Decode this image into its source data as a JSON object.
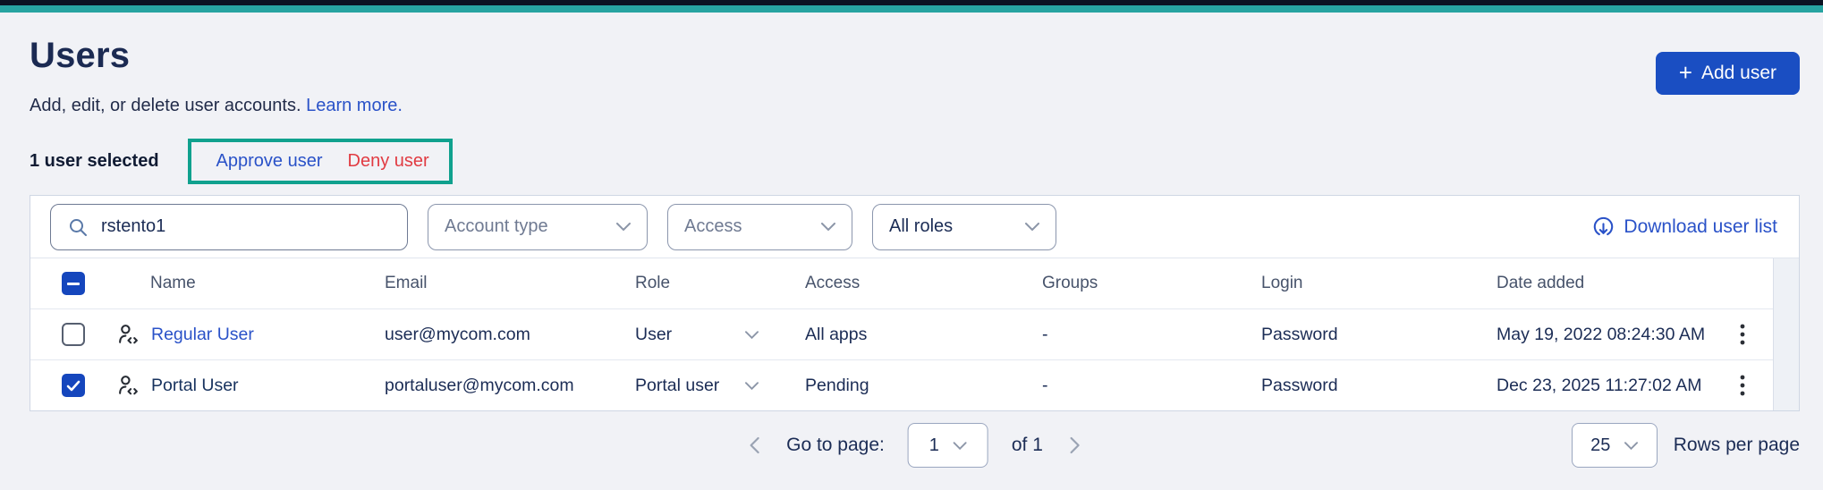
{
  "page": {
    "title": "Users",
    "subtitle": "Add, edit, or delete user accounts.",
    "learn_more_label": "Learn more.",
    "add_user_button": "Add user"
  },
  "selection": {
    "count_label": "1 user selected",
    "approve_label": "Approve user",
    "deny_label": "Deny user"
  },
  "filters": {
    "search_value": "rstento1",
    "account_type_label": "Account type",
    "access_label": "Access",
    "roles_label": "All roles",
    "download_label": "Download user list"
  },
  "table": {
    "columns": {
      "name": "Name",
      "email": "Email",
      "role": "Role",
      "access": "Access",
      "groups": "Groups",
      "login": "Login",
      "date_added": "Date added"
    },
    "rows": [
      {
        "selected": false,
        "name": "Regular User",
        "email": "user@mycom.com",
        "role": "User",
        "access": "All apps",
        "groups": "-",
        "login": "Password",
        "date_added": "May 19, 2022 08:24:30 AM"
      },
      {
        "selected": true,
        "name": "Portal User",
        "email": "portaluser@mycom.com",
        "role": "Portal user",
        "access": "Pending",
        "groups": "-",
        "login": "Password",
        "date_added": "Dec 23, 2025 11:27:02 AM"
      }
    ]
  },
  "pagination": {
    "go_to_page_label": "Go to page:",
    "page_value": "1",
    "of_label": "of 1",
    "rows_per_page_value": "25",
    "rows_per_page_label": "Rows per page"
  },
  "colors": {
    "top_accent_bar": "#27a4a1",
    "primary_button_blue": "#1a4ec2",
    "link_blue": "#2a52c8",
    "danger_red": "#e13b42",
    "annotation_highlight_teal": "#10a18e",
    "navy_text": "#1b2c55"
  }
}
